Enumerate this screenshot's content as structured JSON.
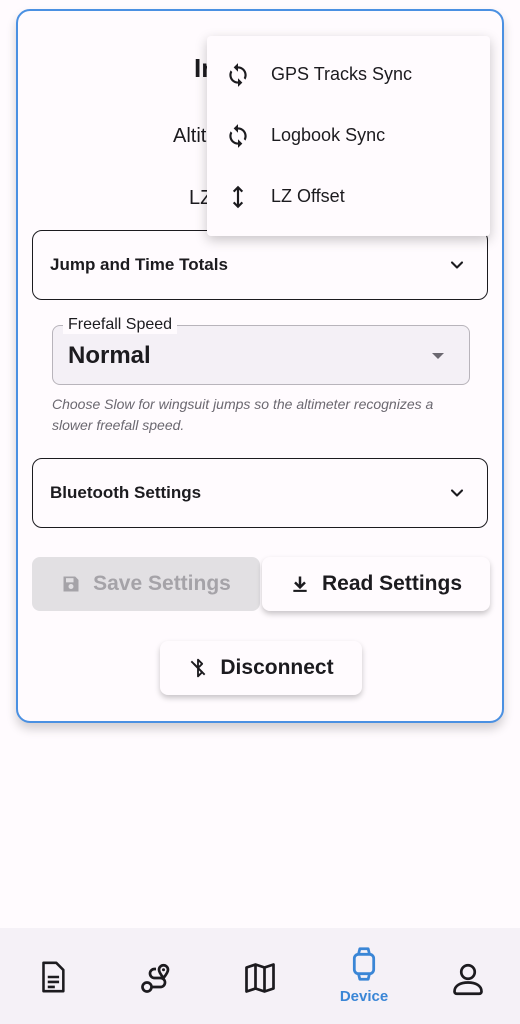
{
  "card": {
    "title_fragment": "In",
    "altitude_fragment": "Altit",
    "lz_fragment": "LZ"
  },
  "sections": {
    "jump_totals_label": "Jump and Time Totals",
    "bluetooth_label": "Bluetooth Settings"
  },
  "freefall": {
    "label": "Freefall Speed",
    "value": "Normal",
    "helper": "Choose Slow for wingsuit jumps so the altimeter recognizes a slower freefall speed."
  },
  "buttons": {
    "save_label": "Save Settings",
    "read_label": "Read Settings",
    "disconnect_label": "Disconnect"
  },
  "menu": {
    "items": [
      {
        "label": "GPS Tracks Sync",
        "icon": "sync-icon"
      },
      {
        "label": "Logbook Sync",
        "icon": "sync-icon"
      },
      {
        "label": "LZ Offset",
        "icon": "vertical-arrows-icon"
      }
    ]
  },
  "bottom_nav": {
    "items": [
      {
        "icon": "logbook-icon",
        "label": ""
      },
      {
        "icon": "tracks-icon",
        "label": ""
      },
      {
        "icon": "map-icon",
        "label": ""
      },
      {
        "icon": "watch-icon",
        "label": "Device",
        "active": true
      },
      {
        "icon": "profile-icon",
        "label": ""
      }
    ]
  },
  "colors": {
    "accent": "#3a86d6",
    "card_border": "#4a90e2",
    "background": "#fffbfe",
    "disabled_button": "#e2e0e3"
  }
}
